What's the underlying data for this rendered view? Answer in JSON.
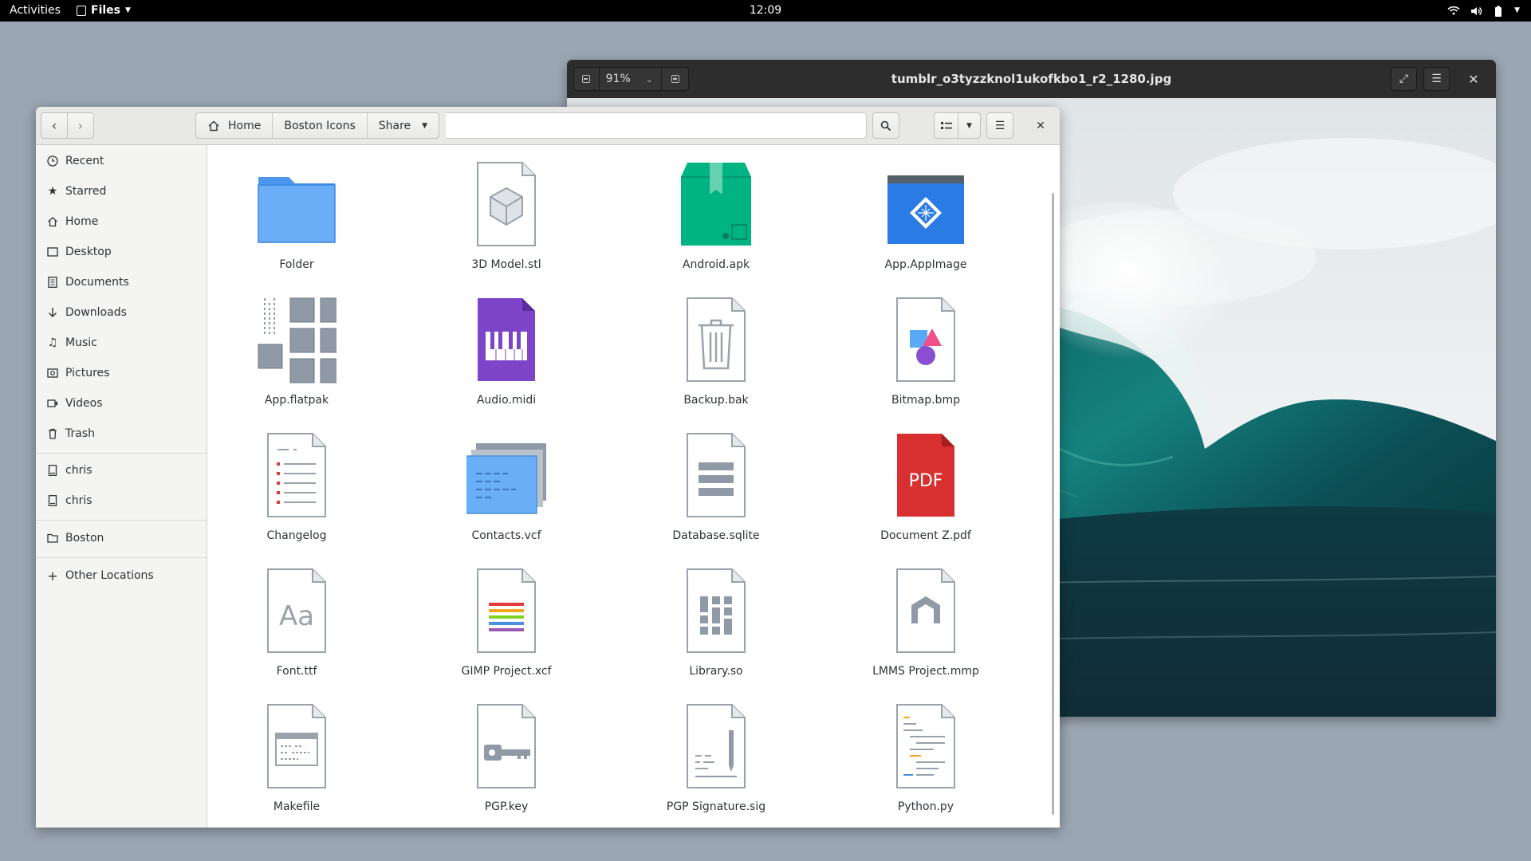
{
  "topbar": {
    "activities": "Activities",
    "app_menu": "Files",
    "clock": "12:09"
  },
  "viewer": {
    "zoom": "91%",
    "title": "tumblr_o3tyzzknol1ukofkbo1_r2_1280.jpg"
  },
  "files": {
    "pathbar": [
      "Home",
      "Boston Icons",
      "Share"
    ],
    "sidebar": {
      "places": [
        "Recent",
        "Starred",
        "Home",
        "Desktop",
        "Documents",
        "Downloads",
        "Music",
        "Pictures",
        "Videos",
        "Trash"
      ],
      "devices": [
        "chris",
        "chris"
      ],
      "bookmarks": [
        "Boston"
      ],
      "other": "Other Locations"
    },
    "items": [
      "Folder",
      "3D Model.stl",
      "Android.apk",
      "App.AppImage",
      "App.flatpak",
      "Audio.midi",
      "Backup.bak",
      "Bitmap.bmp",
      "Changelog",
      "Contacts.vcf",
      "Database.sqlite",
      "Document Z.pdf",
      "Font.ttf",
      "GIMP Project.xcf",
      "Library.so",
      "LMMS Project.mmp",
      "Makefile",
      "PGP.key",
      "PGP Signature.sig",
      "Python.py"
    ],
    "icon_text": {
      "pdf": "PDF",
      "font": "Aa"
    }
  },
  "colors": {
    "desktop": "#9aa6b2",
    "folder": "#6aaef8",
    "apk": "#00b382",
    "appimage": "#2a7be4",
    "midi": "#7e44c8",
    "pdf": "#d83030"
  }
}
